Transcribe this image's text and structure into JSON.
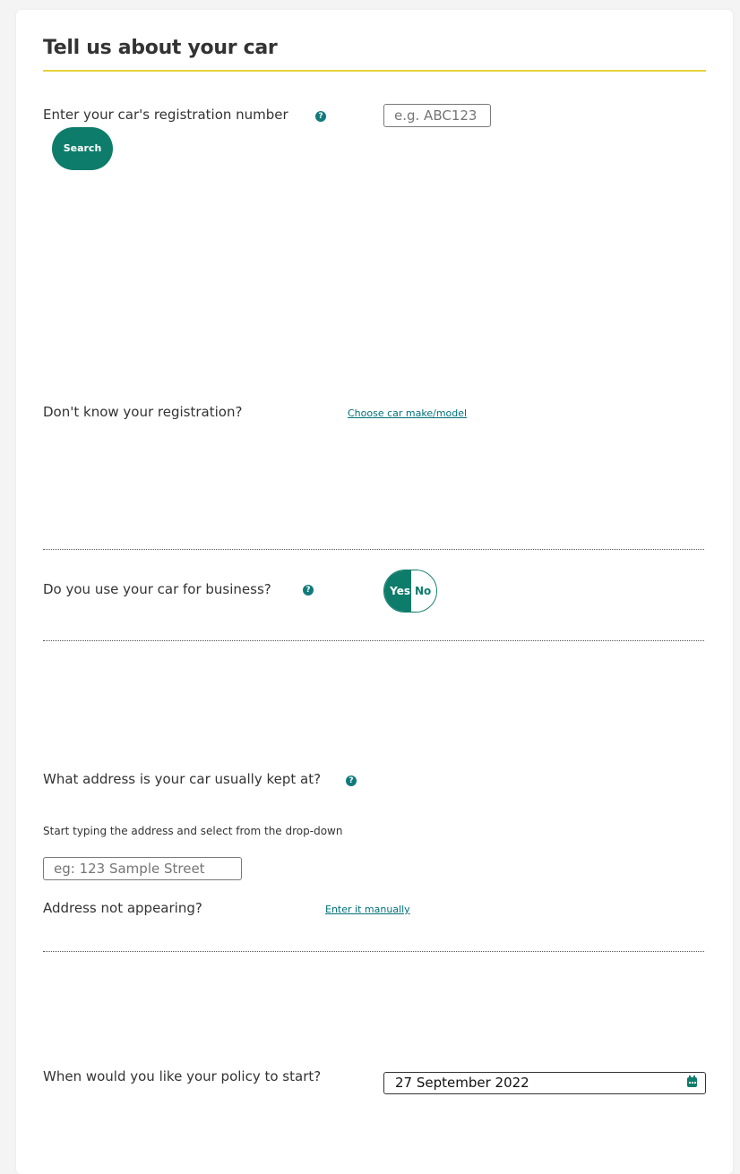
{
  "section": {
    "title": "Tell us about your car"
  },
  "registration": {
    "label": "Enter your car's registration number",
    "help_icon": "?",
    "input_placeholder": "e.g. ABC123",
    "search_label": "Search",
    "unknown_label": "Don't know your registration?",
    "choose_link": "Choose car make/model"
  },
  "business_use": {
    "label": "Do you use your car for business?",
    "help_icon": "?",
    "yes_label": "Yes",
    "no_label": "No",
    "selected": "Yes"
  },
  "address": {
    "label": "What address is your car usually kept at?",
    "help_icon": "?",
    "instruction": "Start typing the address and select from the drop-down",
    "input_placeholder": "eg: 123 Sample Street",
    "not_appearing_label": "Address not appearing?",
    "manual_link": "Enter it manually"
  },
  "policy_start": {
    "label": "When would you like your policy to start?",
    "date_value": "27 September 2022",
    "icon": "calendar-icon"
  },
  "colors": {
    "accent_teal": "#0e7c6b",
    "link_teal": "#00717a",
    "title_underline": "#e6d33a"
  }
}
